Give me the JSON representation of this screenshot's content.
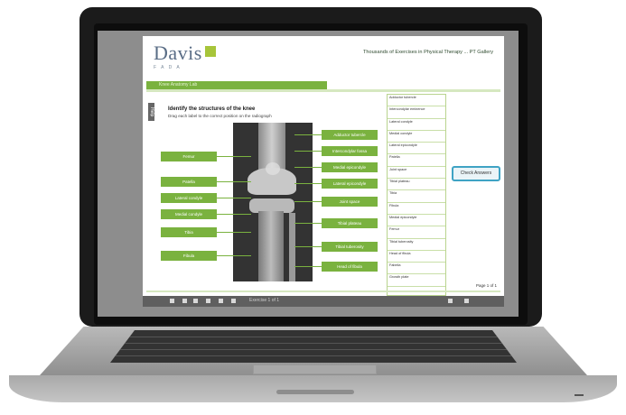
{
  "site": {
    "brand_name": "Davis",
    "brand_subtitle": "F A D A",
    "tagline": "Thousands of Exercises in Physical Therapy ... PT Gallery"
  },
  "nav": {
    "section_label": "Knee Anatomy Lab"
  },
  "exercise": {
    "side_tab": "Help",
    "title": "Identify the structures of the knee",
    "subtitle": "Drag each label to the correct position on the radiograph"
  },
  "labels": {
    "left": [
      "Femur",
      "Patella",
      "Lateral condyle",
      "Medial condyle",
      "Tibia",
      "Fibula"
    ],
    "right": [
      "Adductor tubercle",
      "Intercondylar fossa",
      "Medial epicondyle",
      "Lateral epicondyle",
      "Joint space",
      "Tibial plateau",
      "Tibial tuberosity",
      "Head of fibula"
    ]
  },
  "word_bank": [
    "Adductor tubercle",
    "Intercondylar eminence",
    "Lateral condyle",
    "Medial condyle",
    "Lateral epicondyle",
    "Patella",
    "Joint space",
    "Tibial plateau",
    "Tibia",
    "Fibula",
    "Medial epicondyle",
    "Femur",
    "Tibial tuberosity",
    "Head of fibula",
    "Fabella",
    "Growth plate"
  ],
  "actions": {
    "check_answers": "Check Answers"
  },
  "pager": {
    "page_indicator": "Page 1 of 1"
  },
  "toolbar": {
    "icons": [
      "first-page-icon",
      "prev-page-icon",
      "play-icon",
      "next-page-icon",
      "last-page-icon",
      "print-icon",
      "zoom-icon",
      "close-icon"
    ],
    "status_text": "Exercise 1 of 1"
  },
  "colors": {
    "accent_green": "#7ab23f",
    "check_button_border": "#3fa3c4",
    "brand_text": "#5a6d86"
  }
}
